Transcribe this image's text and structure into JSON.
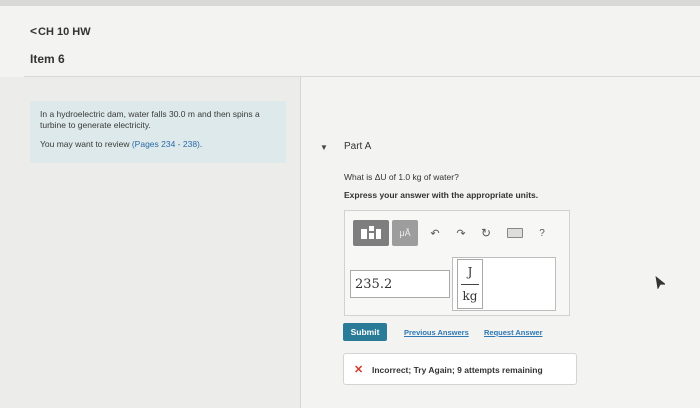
{
  "header": {
    "back_link": "CH 10 HW",
    "item_title": "Item 6"
  },
  "problem": {
    "statement": "In a hydroelectric dam, water falls 30.0 m and then spins a turbine to generate electricity.",
    "review_prefix": "You may want to review",
    "review_pages": "(Pages 234 - 238)",
    "review_suffix": "."
  },
  "part": {
    "caret": "▼",
    "title": "Part A",
    "question": "What is ΔU of 1.0 kg of water?",
    "instruction": "Express your answer with the appropriate units."
  },
  "toolbar": {
    "units_label": "μÅ",
    "undo_icon": "undo-icon",
    "redo_icon": "redo-icon",
    "reset_icon": "reset-icon",
    "keyboard_icon": "keyboard-icon",
    "help_label": "?"
  },
  "answer": {
    "value": "235.2",
    "unit_numerator": "J",
    "unit_denominator": "kg"
  },
  "actions": {
    "submit": "Submit",
    "previous_answers": "Previous Answers",
    "request_answer": "Request Answer"
  },
  "feedback": {
    "icon": "✕",
    "text": "Incorrect; Try Again; 9 attempts remaining"
  },
  "colors": {
    "submit_bg": "#2a7b98",
    "link": "#2e78b5",
    "incorrect_x": "#d2372d",
    "info_box_bg": "#dde9ea"
  }
}
